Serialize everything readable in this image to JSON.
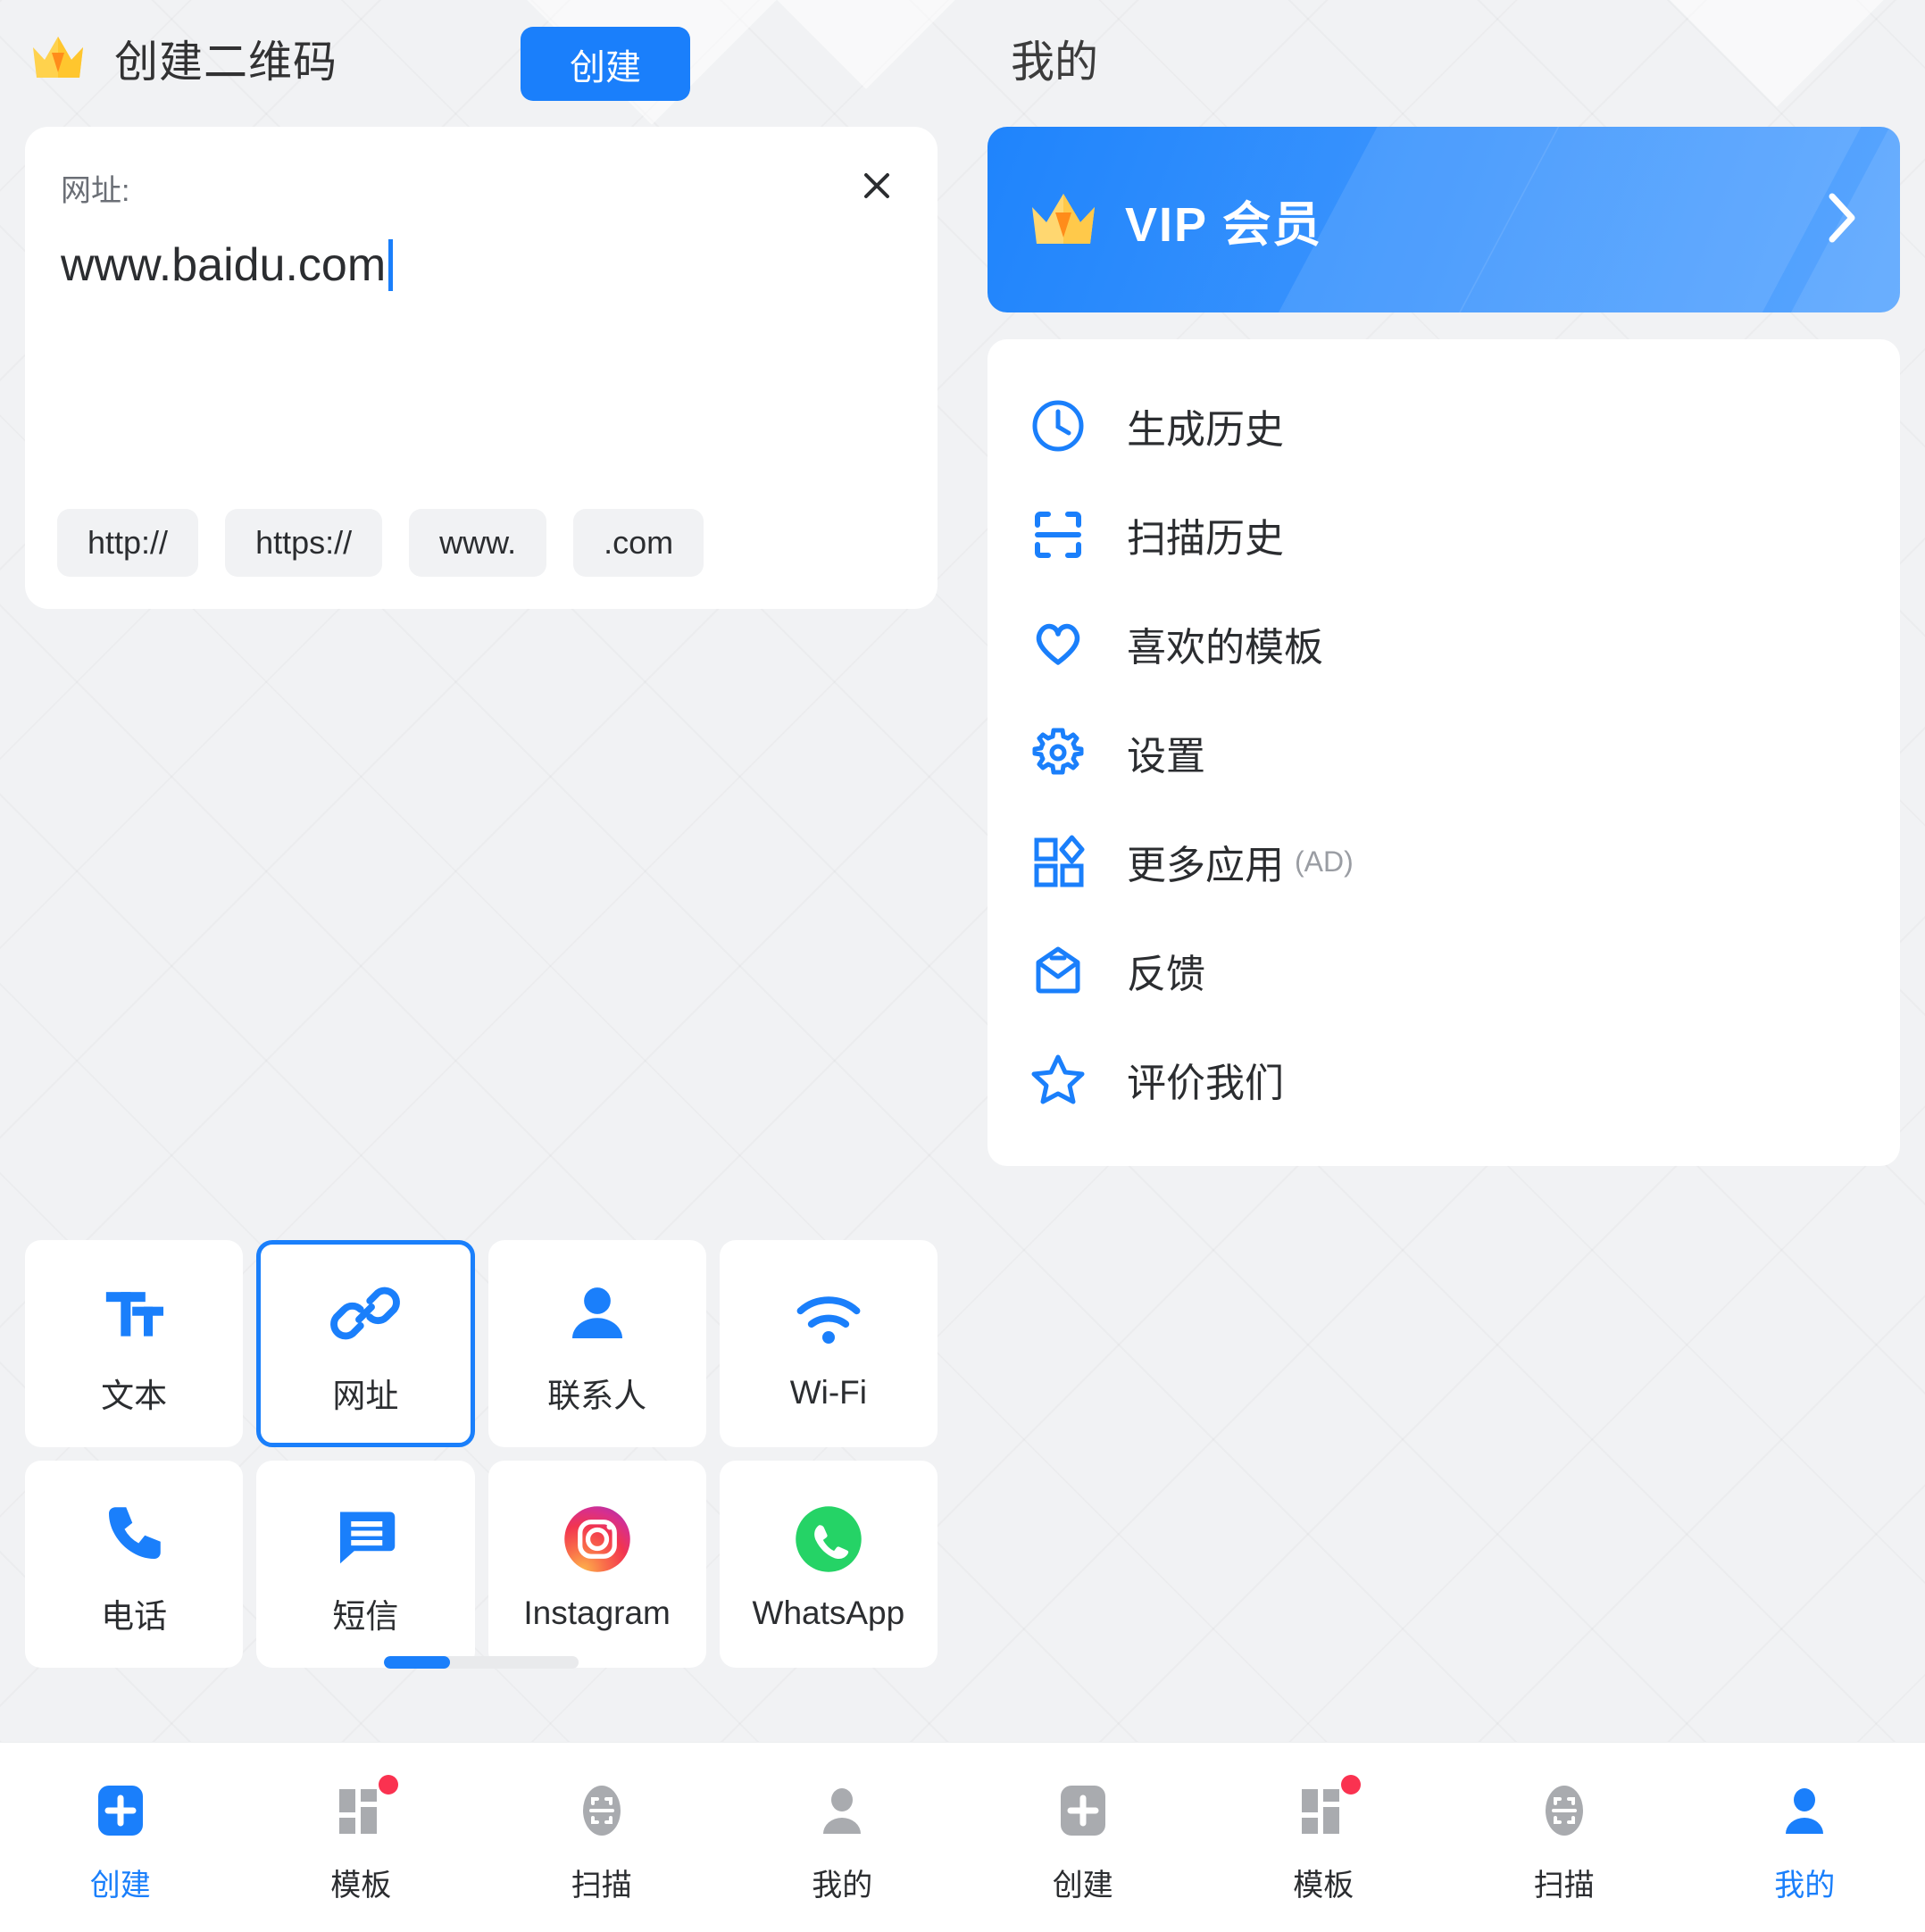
{
  "colors": {
    "accent": "#1a7ffb",
    "background": "#f1f2f4",
    "card": "#ffffff",
    "text": "#2b2d30",
    "muted": "#9a9da3",
    "badge": "#fa3250",
    "crown_gold": "#ffd24d"
  },
  "left": {
    "header": {
      "title": "创建二维码",
      "crown_icon": "crown-icon"
    },
    "create_button": "创建",
    "input_card": {
      "field_label": "网址:",
      "value": "www.baidu.com",
      "close_icon": "close-icon",
      "chips": [
        "http://",
        "https://",
        "www.",
        ".com"
      ]
    },
    "tiles": [
      {
        "label": "文本",
        "icon": "text-format-icon",
        "selected": false
      },
      {
        "label": "网址",
        "icon": "link-icon",
        "selected": true
      },
      {
        "label": "联系人",
        "icon": "person-icon",
        "selected": false
      },
      {
        "label": "Wi-Fi",
        "icon": "wifi-icon",
        "selected": false
      },
      {
        "label": "电话",
        "icon": "phone-icon",
        "selected": false
      },
      {
        "label": "短信",
        "icon": "message-icon",
        "selected": false
      },
      {
        "label": "Instagram",
        "icon": "instagram-icon",
        "selected": false
      },
      {
        "label": "WhatsApp",
        "icon": "whatsapp-icon",
        "selected": false
      }
    ]
  },
  "right": {
    "header": {
      "title": "我的"
    },
    "vip_banner": {
      "title": "VIP 会员",
      "crown_icon": "crown-icon",
      "chevron_icon": "chevron-right-icon"
    },
    "menu": [
      {
        "label": "生成历史",
        "icon": "clock-icon",
        "sub": ""
      },
      {
        "label": "扫描历史",
        "icon": "scan-icon",
        "sub": ""
      },
      {
        "label": "喜欢的模板",
        "icon": "heart-icon",
        "sub": ""
      },
      {
        "label": "设置",
        "icon": "gear-icon",
        "sub": ""
      },
      {
        "label": "更多应用",
        "icon": "apps-grid-icon",
        "sub": "(AD)"
      },
      {
        "label": "反馈",
        "icon": "envelope-icon",
        "sub": ""
      },
      {
        "label": "评价我们",
        "icon": "star-icon",
        "sub": ""
      }
    ]
  },
  "navbar": {
    "left_items": [
      {
        "label": "创建",
        "icon": "plus-square-icon",
        "active": true,
        "badge": false
      },
      {
        "label": "模板",
        "icon": "template-grid-icon",
        "active": false,
        "badge": true
      },
      {
        "label": "扫描",
        "icon": "scan-circle-icon",
        "active": false,
        "badge": false
      },
      {
        "label": "我的",
        "icon": "person-icon",
        "active": false,
        "badge": false
      }
    ],
    "right_items": [
      {
        "label": "创建",
        "icon": "plus-square-icon",
        "active": false,
        "badge": false
      },
      {
        "label": "模板",
        "icon": "template-grid-icon",
        "active": false,
        "badge": true
      },
      {
        "label": "扫描",
        "icon": "scan-circle-icon",
        "active": false,
        "badge": false
      },
      {
        "label": "我的",
        "icon": "person-icon",
        "active": true,
        "badge": false
      }
    ]
  }
}
